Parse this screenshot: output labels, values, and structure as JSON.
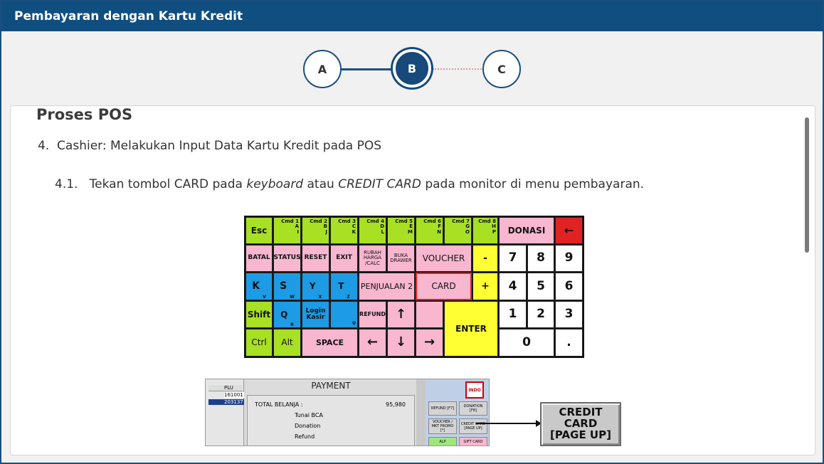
{
  "header": {
    "title": "Pembayaran dengan Kartu Kredit"
  },
  "steps": [
    {
      "label": "A"
    },
    {
      "label": "B"
    },
    {
      "label": "C"
    }
  ],
  "content": {
    "section_title": "Proses POS",
    "item4_number": "4.",
    "item4_text": "Cashier: Melakukan Input Data Kartu Kredit pada POS",
    "item41_number": "4.1.",
    "item41_part1": "Tekan tombol CARD pada ",
    "item41_em1": "keyboard",
    "item41_part2": " atau ",
    "item41_em2": "CREDIT CARD",
    "item41_part3": " pada monitor di menu pembayaran."
  },
  "keyboard": {
    "esc": "Esc",
    "cmd1": "Cmd 1",
    "cmd1k": "A",
    "cmd1k2": "I",
    "cmd2": "Cmd 2",
    "cmd2k": "B",
    "cmd2k2": "J",
    "cmd3": "Cmd 3",
    "cmd3k": "C",
    "cmd3k2": "K",
    "cmd4": "Cmd 4",
    "cmd4k": "D",
    "cmd4k2": "L",
    "cmd5": "Cmd 5",
    "cmd5k": "E",
    "cmd5k2": "M",
    "cmd6": "Cmd 6",
    "cmd6k": "F",
    "cmd6k2": "N",
    "cmd7": "Cmd 7",
    "cmd7k": "G",
    "cmd7k2": "O",
    "cmd8": "Cmd 8",
    "cmd8k": "H",
    "cmd8k2": "P",
    "donasi": "DONASI",
    "backspace": "←",
    "batal": "BATAL",
    "status": "STATUS",
    "reset": "RESET",
    "exit": "EXIT",
    "rubah": "RUBAH HARGA /CALC",
    "buka": "BUKA DRAWER",
    "voucher": "VOUCHER",
    "minus": "-",
    "n7": "7",
    "n8": "8",
    "n9": "9",
    "k": "K",
    "kv": "V",
    "s": "S",
    "sw": "W",
    "y": "Y",
    "yx": "X",
    "t": "T",
    "tz": "Z",
    "penjualan": "PENJUALAN 2",
    "card": "CARD",
    "plus": "+",
    "n4": "4",
    "n5": "5",
    "n6": "6",
    "shift": "Shift",
    "q": "Q",
    "qr": "R",
    "login": "Login Kasir",
    "u": "U",
    "refund": "REFUND",
    "up": "↑",
    "enter": "ENTER",
    "n1": "1",
    "n2": "2",
    "n3": "3",
    "ctrl": "Ctrl",
    "alt": "Alt",
    "space": "SPACE",
    "left": "←",
    "down": "↓",
    "right": "→",
    "n0": "0",
    "dot": "."
  },
  "payment": {
    "title": "PAYMENT",
    "plu_header": "PLU",
    "plu_rows": [
      "161001",
      "203137"
    ],
    "total_label": "TOTAL BELANJA :",
    "total_value": "95,980",
    "rows": [
      "Tunai BCA",
      "Donation",
      "Refund"
    ],
    "logo": "INDO",
    "btn_refund": "REFUND [F7]",
    "btn_donation": "DONATION [F8]",
    "btn_voucher": "VOUCHER / MKT PROMO [*]",
    "btn_credit": "CREDIT CARD [PAGE UP]",
    "btn_alp": "ALP",
    "btn_gift": "GIFT CARD"
  },
  "callout": {
    "line1": "CREDIT",
    "line2": "CARD",
    "line3": "[PAGE UP]"
  },
  "colors": {
    "header": "#114e80",
    "key_green": "#a8e024",
    "key_pink": "#f8b6cf",
    "key_blue": "#1d9be4",
    "key_yellow": "#ffff33",
    "key_red": "#e12222"
  }
}
